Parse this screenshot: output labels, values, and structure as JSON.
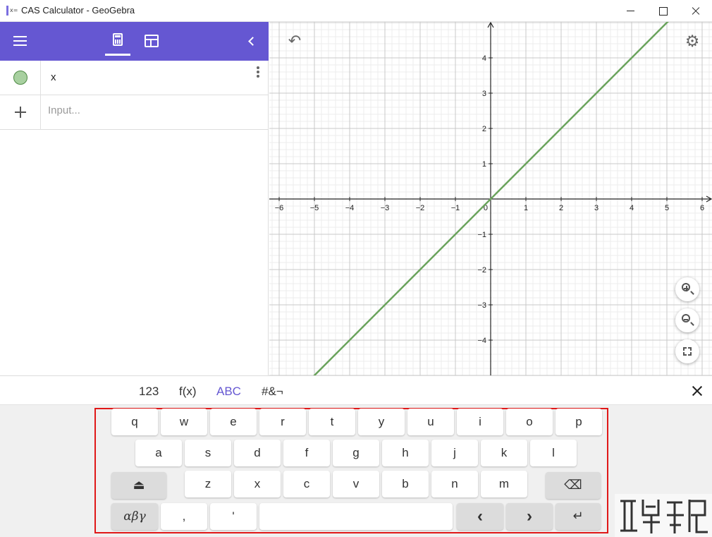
{
  "window": {
    "title": "CAS Calculator - GeoGebra",
    "app_icon_label": "x="
  },
  "algebra": {
    "tabs": [
      {
        "name": "algebra",
        "icon": "calculator-icon",
        "active": true
      },
      {
        "name": "table",
        "icon": "table-icon",
        "active": false
      }
    ],
    "header_color": "#6557d2",
    "items": [
      {
        "expression": "x",
        "marble_color": "#a8d0a0"
      }
    ],
    "input_placeholder": "Input..."
  },
  "graphics": {
    "undo_icon": "undo-icon",
    "settings_icon": "gear-icon",
    "zoom_in_icon": "zoom-in-icon",
    "zoom_out_icon": "zoom-out-icon",
    "fullscreen_icon": "fullscreen-icon",
    "x_ticks": [
      "−6",
      "−5",
      "−4",
      "−3",
      "−2",
      "−1",
      "0",
      "1",
      "2",
      "3",
      "4",
      "5",
      "6"
    ],
    "y_ticks": [
      "4",
      "3",
      "2",
      "1",
      "−1",
      "−2",
      "−3",
      "−4"
    ],
    "xlim": [
      -6.2,
      6.2
    ],
    "ylim": [
      -5,
      5
    ],
    "function": "y = x",
    "line_color": "#6aa35c"
  },
  "keyboard": {
    "tabs": [
      {
        "label": "123",
        "active": false
      },
      {
        "label": "f(x)",
        "active": false
      },
      {
        "label": "ABC",
        "active": true
      },
      {
        "label": "#&¬",
        "active": false
      }
    ],
    "accent_color": "#6557d2",
    "row1": [
      "q",
      "w",
      "e",
      "r",
      "t",
      "y",
      "u",
      "i",
      "o",
      "p"
    ],
    "row2": [
      "a",
      "s",
      "d",
      "f",
      "g",
      "h",
      "j",
      "k",
      "l"
    ],
    "row3": [
      "z",
      "x",
      "c",
      "v",
      "b",
      "n",
      "m"
    ],
    "row4": {
      "greek": "αβγ",
      "comma": ",",
      "apostrophe": "'",
      "left": "‹",
      "right": "›"
    },
    "shift_icon": "shift-icon",
    "backspace_icon": "backspace-icon",
    "enter_icon": "enter-icon"
  }
}
